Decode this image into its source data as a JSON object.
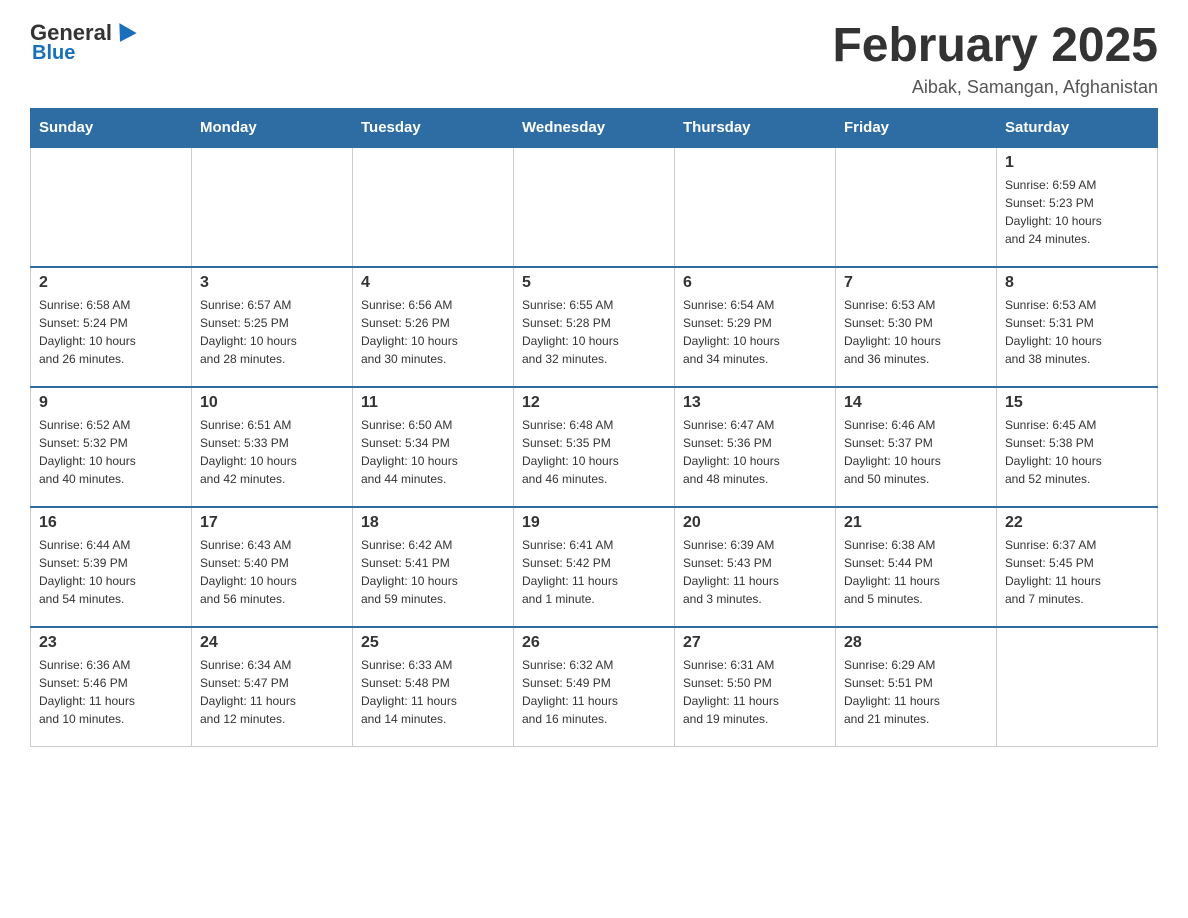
{
  "header": {
    "logo_general": "General",
    "logo_blue": "Blue",
    "month_title": "February 2025",
    "location": "Aibak, Samangan, Afghanistan"
  },
  "weekdays": [
    "Sunday",
    "Monday",
    "Tuesday",
    "Wednesday",
    "Thursday",
    "Friday",
    "Saturday"
  ],
  "weeks": [
    [
      {
        "day": "",
        "info": ""
      },
      {
        "day": "",
        "info": ""
      },
      {
        "day": "",
        "info": ""
      },
      {
        "day": "",
        "info": ""
      },
      {
        "day": "",
        "info": ""
      },
      {
        "day": "",
        "info": ""
      },
      {
        "day": "1",
        "info": "Sunrise: 6:59 AM\nSunset: 5:23 PM\nDaylight: 10 hours\nand 24 minutes."
      }
    ],
    [
      {
        "day": "2",
        "info": "Sunrise: 6:58 AM\nSunset: 5:24 PM\nDaylight: 10 hours\nand 26 minutes."
      },
      {
        "day": "3",
        "info": "Sunrise: 6:57 AM\nSunset: 5:25 PM\nDaylight: 10 hours\nand 28 minutes."
      },
      {
        "day": "4",
        "info": "Sunrise: 6:56 AM\nSunset: 5:26 PM\nDaylight: 10 hours\nand 30 minutes."
      },
      {
        "day": "5",
        "info": "Sunrise: 6:55 AM\nSunset: 5:28 PM\nDaylight: 10 hours\nand 32 minutes."
      },
      {
        "day": "6",
        "info": "Sunrise: 6:54 AM\nSunset: 5:29 PM\nDaylight: 10 hours\nand 34 minutes."
      },
      {
        "day": "7",
        "info": "Sunrise: 6:53 AM\nSunset: 5:30 PM\nDaylight: 10 hours\nand 36 minutes."
      },
      {
        "day": "8",
        "info": "Sunrise: 6:53 AM\nSunset: 5:31 PM\nDaylight: 10 hours\nand 38 minutes."
      }
    ],
    [
      {
        "day": "9",
        "info": "Sunrise: 6:52 AM\nSunset: 5:32 PM\nDaylight: 10 hours\nand 40 minutes."
      },
      {
        "day": "10",
        "info": "Sunrise: 6:51 AM\nSunset: 5:33 PM\nDaylight: 10 hours\nand 42 minutes."
      },
      {
        "day": "11",
        "info": "Sunrise: 6:50 AM\nSunset: 5:34 PM\nDaylight: 10 hours\nand 44 minutes."
      },
      {
        "day": "12",
        "info": "Sunrise: 6:48 AM\nSunset: 5:35 PM\nDaylight: 10 hours\nand 46 minutes."
      },
      {
        "day": "13",
        "info": "Sunrise: 6:47 AM\nSunset: 5:36 PM\nDaylight: 10 hours\nand 48 minutes."
      },
      {
        "day": "14",
        "info": "Sunrise: 6:46 AM\nSunset: 5:37 PM\nDaylight: 10 hours\nand 50 minutes."
      },
      {
        "day": "15",
        "info": "Sunrise: 6:45 AM\nSunset: 5:38 PM\nDaylight: 10 hours\nand 52 minutes."
      }
    ],
    [
      {
        "day": "16",
        "info": "Sunrise: 6:44 AM\nSunset: 5:39 PM\nDaylight: 10 hours\nand 54 minutes."
      },
      {
        "day": "17",
        "info": "Sunrise: 6:43 AM\nSunset: 5:40 PM\nDaylight: 10 hours\nand 56 minutes."
      },
      {
        "day": "18",
        "info": "Sunrise: 6:42 AM\nSunset: 5:41 PM\nDaylight: 10 hours\nand 59 minutes."
      },
      {
        "day": "19",
        "info": "Sunrise: 6:41 AM\nSunset: 5:42 PM\nDaylight: 11 hours\nand 1 minute."
      },
      {
        "day": "20",
        "info": "Sunrise: 6:39 AM\nSunset: 5:43 PM\nDaylight: 11 hours\nand 3 minutes."
      },
      {
        "day": "21",
        "info": "Sunrise: 6:38 AM\nSunset: 5:44 PM\nDaylight: 11 hours\nand 5 minutes."
      },
      {
        "day": "22",
        "info": "Sunrise: 6:37 AM\nSunset: 5:45 PM\nDaylight: 11 hours\nand 7 minutes."
      }
    ],
    [
      {
        "day": "23",
        "info": "Sunrise: 6:36 AM\nSunset: 5:46 PM\nDaylight: 11 hours\nand 10 minutes."
      },
      {
        "day": "24",
        "info": "Sunrise: 6:34 AM\nSunset: 5:47 PM\nDaylight: 11 hours\nand 12 minutes."
      },
      {
        "day": "25",
        "info": "Sunrise: 6:33 AM\nSunset: 5:48 PM\nDaylight: 11 hours\nand 14 minutes."
      },
      {
        "day": "26",
        "info": "Sunrise: 6:32 AM\nSunset: 5:49 PM\nDaylight: 11 hours\nand 16 minutes."
      },
      {
        "day": "27",
        "info": "Sunrise: 6:31 AM\nSunset: 5:50 PM\nDaylight: 11 hours\nand 19 minutes."
      },
      {
        "day": "28",
        "info": "Sunrise: 6:29 AM\nSunset: 5:51 PM\nDaylight: 11 hours\nand 21 minutes."
      },
      {
        "day": "",
        "info": ""
      }
    ]
  ]
}
